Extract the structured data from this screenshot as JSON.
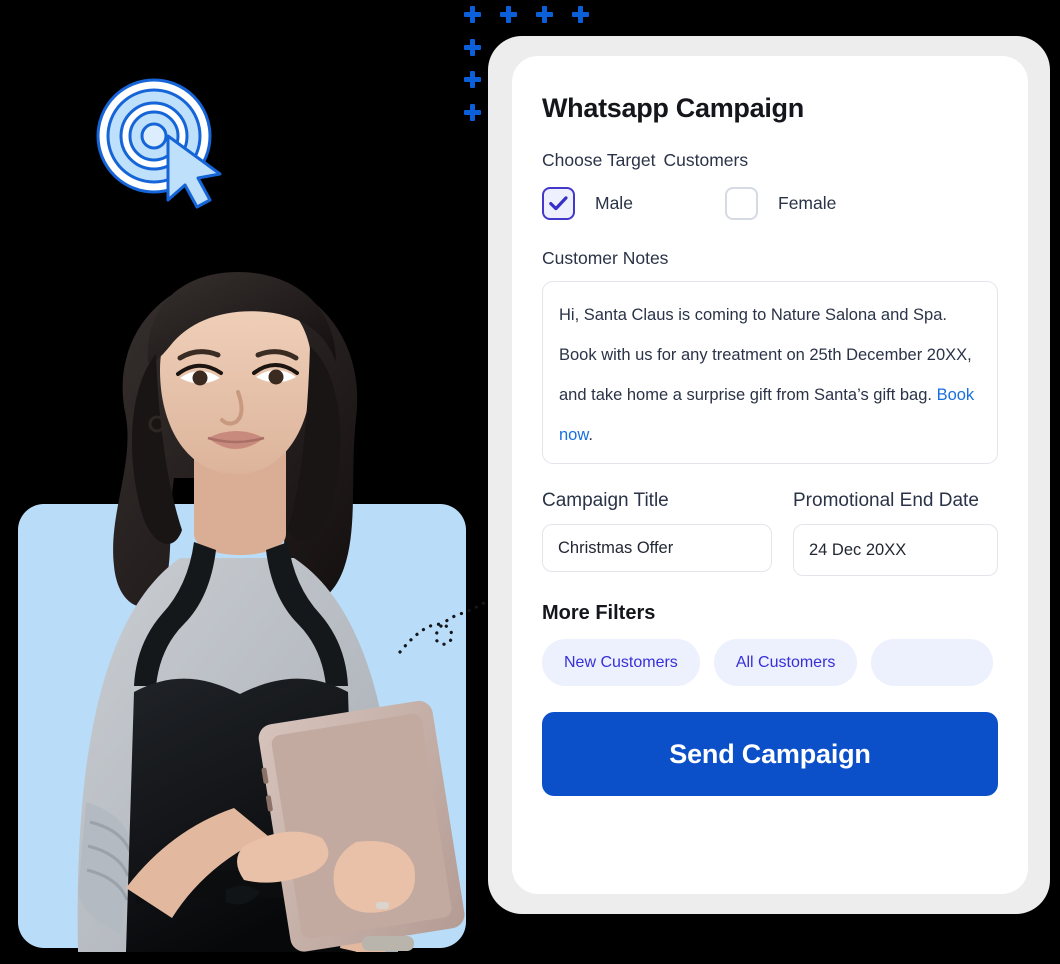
{
  "card": {
    "title": "Whatsapp Campaign",
    "target_label_part1": "Choose Target",
    "target_label_part2": "Customers",
    "options": [
      {
        "label": "Male",
        "checked": true
      },
      {
        "label": "Female",
        "checked": false
      }
    ],
    "notes_label": "Customer Notes",
    "notes_text_before_link": "Hi, Santa Claus is coming to Nature Salona and Spa. Book with us for any treatment on 25th December 20XX, and take home a surprise gift from Santa’s gift bag. ",
    "notes_link_text": "Book now",
    "notes_text_after_link": ".",
    "campaign_title_label": "Campaign Title",
    "campaign_title_value": "Christmas Offer",
    "end_date_label": "Promotional End Date",
    "end_date_value": "24 Dec 20XX",
    "more_filters_label": "More Filters",
    "filters": [
      "New Customers",
      "All Customers",
      ""
    ],
    "send_label": "Send Campaign"
  },
  "decor": {
    "target_icon": "target-cursor-icon",
    "plus_icon": "plus-icon",
    "photo": "woman-with-tablet-photo",
    "connector": "dotted-curve-connector"
  },
  "colors": {
    "page_background": "#000000",
    "card_background": "#FFFFFF",
    "card_backdrop": "#EDEDED",
    "primary_button": "#0B4FC9",
    "link": "#1A6FE0",
    "checkbox_accent": "#4338CA",
    "checkbox_fill": "#EEF0FE",
    "pill_background": "#EDF0FD",
    "pill_text": "#3730D8",
    "photo_background": "#B9DDF8",
    "plus_color": "#0B5FD9",
    "heading_text": "#14161C",
    "body_text": "#2A3347"
  }
}
